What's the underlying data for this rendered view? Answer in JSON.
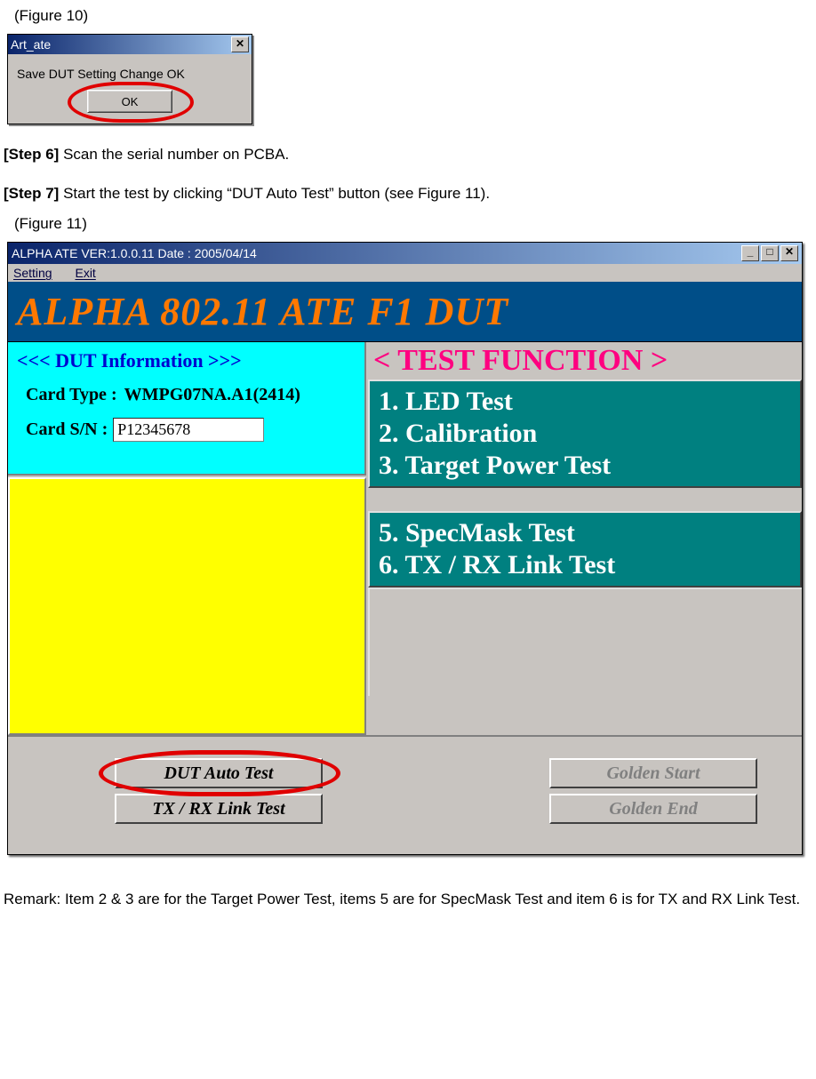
{
  "captions": {
    "fig10": "(Figure 10)",
    "fig11": "(Figure 11)"
  },
  "steps": {
    "s6_label": "[Step 6]",
    "s6_text": " Scan the serial number on PCBA.",
    "s7_label": "[Step 7]",
    "s7_text": " Start the test by clicking “DUT Auto Test” button (see Figure 11)."
  },
  "remark": "Remark: Item 2 & 3 are for the Target Power Test, items 5 are for SpecMask Test and item 6 is for TX and RX Link Test.",
  "dialog1": {
    "title": "Art_ate",
    "message": "Save DUT Setting Change OK",
    "ok": "OK"
  },
  "dialog2": {
    "title": "ALPHA  ATE   VER:1.0.0.11  Date : 2005/04/14",
    "menu": {
      "setting": "Setting",
      "exit": "Exit"
    },
    "banner": "ALPHA   802.11   ATE   F1 DUT",
    "info_header": "<<<   DUT Information   >>>",
    "card_type_label": "Card Type :",
    "card_type_value": "WMPG07NA.A1(2414)",
    "card_sn_label": "Card S/N    :",
    "card_sn_value": "P12345678",
    "func_header": "<  TEST    FUNCTION  >",
    "func": {
      "f1": "1.   LED   Test",
      "f2": "2.   Calibration",
      "f3": "3.   Target Power Test",
      "f5": "5.   SpecMask Test",
      "f6": "6.   TX / RX Link Test"
    },
    "buttons": {
      "auto": "DUT Auto Test",
      "link": "TX / RX Link Test",
      "gstart": "Golden Start",
      "gend": "Golden End"
    }
  }
}
